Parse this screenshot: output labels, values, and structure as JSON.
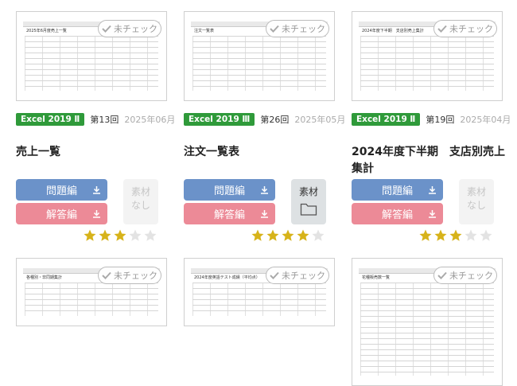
{
  "check_label": "未チェック",
  "buttons": {
    "question": "問題編",
    "answer": "解答編"
  },
  "material_none": [
    "素材",
    "なし"
  ],
  "material_has": "素材",
  "colors": {
    "badge": "#2f9a3a",
    "question_btn": "#6b92c9",
    "answer_btn": "#ec8a97",
    "star_on": "#d7b31a",
    "star_off": "#e3e3e3"
  },
  "cards": [
    {
      "thumb_title": "2025年6月度売上一覧",
      "badge": "Excel 2019 Ⅱ",
      "episode": "第13回",
      "date": "2025年06月",
      "title": "売上一覧",
      "material": false,
      "stars": 3
    },
    {
      "thumb_title": "注文一覧表",
      "badge": "Excel 2019 Ⅲ",
      "episode": "第26回",
      "date": "2025年05月",
      "title": "注文一覧表",
      "material": true,
      "stars": 4
    },
    {
      "thumb_title": "2024年度下半期　支店別売上集計",
      "badge": "Excel 2019 Ⅱ",
      "episode": "第19回",
      "date": "2025年04月",
      "title": "2024年度下半期　支店別売上集計",
      "material": false,
      "stars": 3
    },
    {
      "thumb_title": "各種別・非同期集計"
    },
    {
      "thumb_title": "2024年度英語テスト成績（平均点）"
    },
    {
      "thumb_title": "花種販売数一覧"
    }
  ]
}
